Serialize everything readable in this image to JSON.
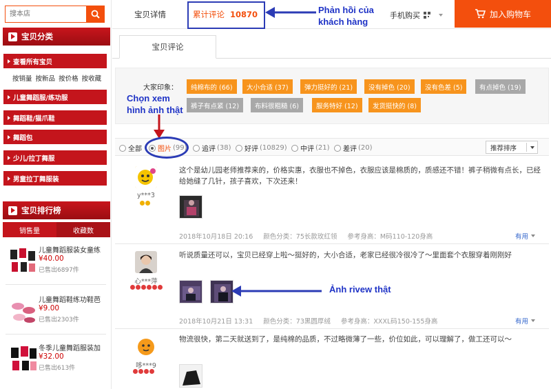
{
  "colors": {
    "accent": "#f34f0d",
    "brand_red": "#c4151c",
    "tag_positive": "#f7941d",
    "tag_negative": "#a8a8a8",
    "annotation": "#1f33c6"
  },
  "sidebar": {
    "search": {
      "placeholder": "搜本店",
      "icon": "search-icon"
    },
    "category_title": "宝贝分类",
    "categories": [
      {
        "label": "查看所有宝贝"
      },
      {
        "label": "儿童舞蹈服/练功服"
      },
      {
        "label": "舞蹈鞋/猫爪鞋"
      },
      {
        "label": "舞蹈包"
      },
      {
        "label": "少儿/拉丁舞服"
      },
      {
        "label": "男童拉丁舞服装"
      }
    ],
    "sort_links": [
      "按销量",
      "按新品",
      "按价格",
      "按收藏"
    ],
    "ranking_title": "宝贝排行榜",
    "ranking_tabs": [
      "销售量",
      "收藏数"
    ],
    "ranking_items": [
      {
        "title": "儿童舞蹈服装女童练",
        "price": "¥40.00",
        "sold": "已售出6897件"
      },
      {
        "title": "儿童舞蹈鞋练功鞋芭",
        "price": "¥9.00",
        "sold": "已售出2303件"
      },
      {
        "title": "冬季儿童舞蹈服装加",
        "price": "¥32.00",
        "sold": "已售出613件"
      }
    ]
  },
  "nav": {
    "tabs": [
      {
        "label": "宝贝详情"
      },
      {
        "label": "累计评论",
        "count": "10870"
      }
    ],
    "mobile_buy": "手机购买",
    "cart": "加入购物车"
  },
  "reviews_tab": "宝贝评论",
  "impressions": {
    "label": "大家印象：",
    "tags": [
      {
        "label": "纯棉布的 (66)",
        "type": "positive"
      },
      {
        "label": "大小合适 (37)",
        "type": "positive"
      },
      {
        "label": "弹力挺好的 (21)",
        "type": "positive"
      },
      {
        "label": "没有掉色 (20)",
        "type": "positive"
      },
      {
        "label": "没有色差 (5)",
        "type": "positive"
      },
      {
        "label": "有点掉色 (19)",
        "type": "negative"
      },
      {
        "label": "裤子有点紧 (12)",
        "type": "negative"
      },
      {
        "label": "布料很粗糙 (6)",
        "type": "negative"
      },
      {
        "label": "服务特好 (12)",
        "type": "positive"
      },
      {
        "label": "发货挺快的 (8)",
        "type": "positive"
      }
    ]
  },
  "filters": {
    "options": [
      {
        "label": "全部",
        "count": ""
      },
      {
        "label": "图片",
        "count": "(99)"
      },
      {
        "label": "追评",
        "count": "(38)"
      },
      {
        "label": "好评",
        "count": "(10829)"
      },
      {
        "label": "中评",
        "count": "(21)"
      },
      {
        "label": "差评",
        "count": "(20)"
      }
    ],
    "selected": "图片",
    "sort": "推荐排序"
  },
  "reviews": [
    {
      "user": "y***3",
      "text": "这个是幼儿园老师推荐来的，价格实惠，衣服也不掉色，衣服应该是棉质的，质感还不错！裤子稍微有点长，已经给她缝了几针，孩子喜欢，下次还来！",
      "date": "2018年10月18日 20:16",
      "color": "颜色分类：75长款玫红领",
      "height": "参考身高：M码110-120身高",
      "useful": "有用"
    },
    {
      "user": "心***萍",
      "text": "听说质量还可以，宝贝已经穿上啦～挺好的，大小合适，老家已经很冷很冷了～里面套个衣服穿着刚刚好",
      "date": "2018年10月21日 13:31",
      "color": "颜色分类：73黑圆厚绒",
      "height": "参考身高：XXXL码150-155身高",
      "useful": "有用"
    },
    {
      "user": "哆***9",
      "text": "物流很快，第二天就送到了，是纯棉的品质，不过略微薄了一些，价位如此，可以理解了，做工还可以～"
    }
  ],
  "annotations": {
    "feedback": "Phản hồi của khách hàng",
    "choose": "Chọn xem hình ảnh thật",
    "real_review": "Ảnh rivew thật"
  }
}
